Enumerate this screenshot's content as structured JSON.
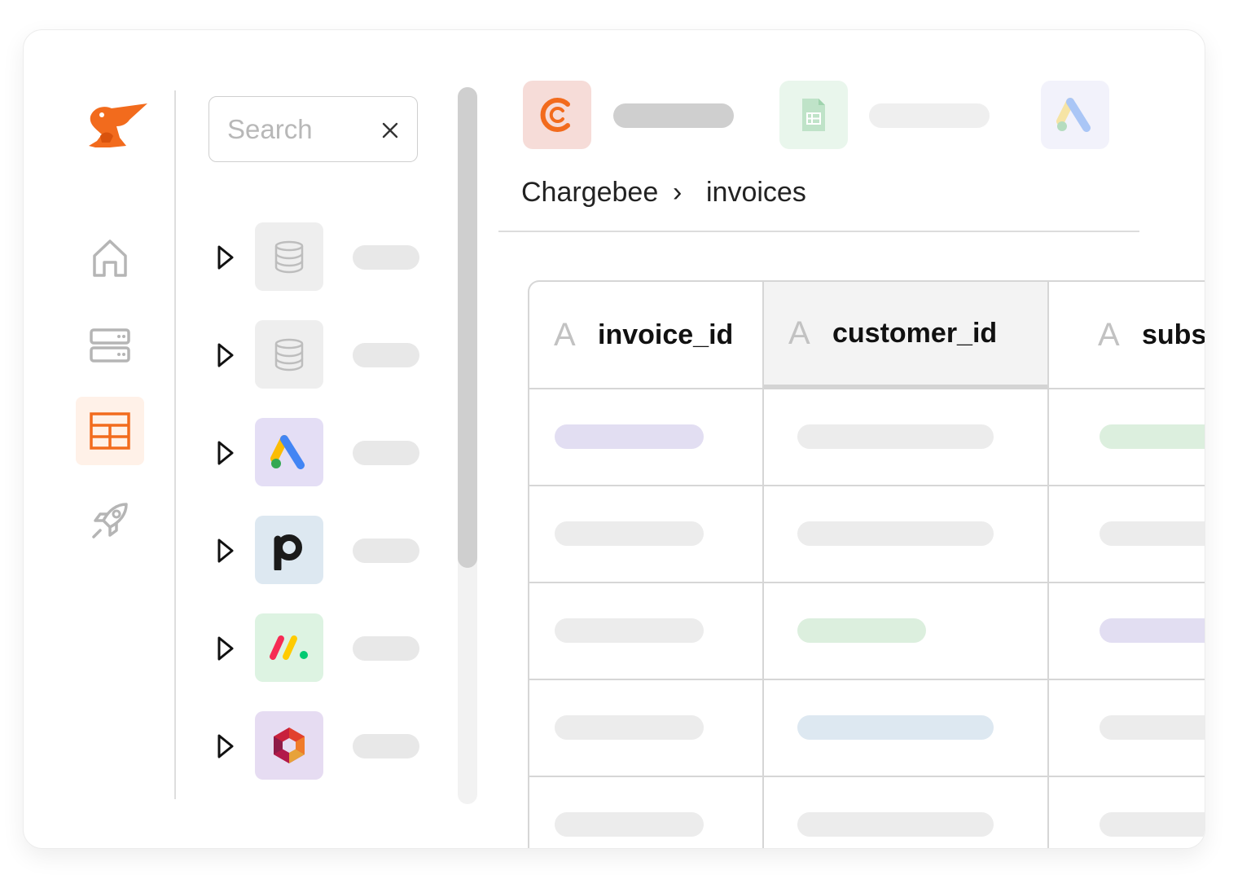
{
  "app": {
    "brand_color": "#f26b1d",
    "nav": [
      {
        "icon": "home-icon",
        "active": false
      },
      {
        "icon": "server-icon",
        "active": false
      },
      {
        "icon": "table-icon",
        "active": true
      },
      {
        "icon": "rocket-icon",
        "active": false
      }
    ]
  },
  "search": {
    "placeholder": "Search",
    "value": ""
  },
  "sources": [
    {
      "icon": "database-icon",
      "bg": "#eeeeee"
    },
    {
      "icon": "database-icon",
      "bg": "#eeeeee"
    },
    {
      "icon": "google-ads-icon",
      "bg": "#e4def5"
    },
    {
      "icon": "pipedrive-icon",
      "bg": "#dde8f1"
    },
    {
      "icon": "monday-icon",
      "bg": "#ddf3e2"
    },
    {
      "icon": "hexagon-logo-icon",
      "bg": "#e6dcf2"
    }
  ],
  "connectors": [
    {
      "icon": "chargebee-icon",
      "bg": "#f6dcd8"
    },
    {
      "icon": "google-sheets-icon",
      "bg": "#e9f6ec"
    },
    {
      "icon": "google-ads-icon",
      "bg": "#f2f2fb"
    }
  ],
  "breadcrumb": {
    "source": "Chargebee",
    "separator": "›",
    "table": "invoices"
  },
  "table": {
    "columns": [
      {
        "type_glyph": "A",
        "name": "invoice_id",
        "selected": false
      },
      {
        "type_glyph": "A",
        "name": "customer_id",
        "selected": true
      },
      {
        "type_glyph": "A",
        "name": "subs",
        "selected": false
      }
    ],
    "pill_colors": {
      "grey": "#ececec",
      "purple": "#e2def2",
      "green": "#dcefde",
      "blue": "#dde8f1"
    }
  }
}
